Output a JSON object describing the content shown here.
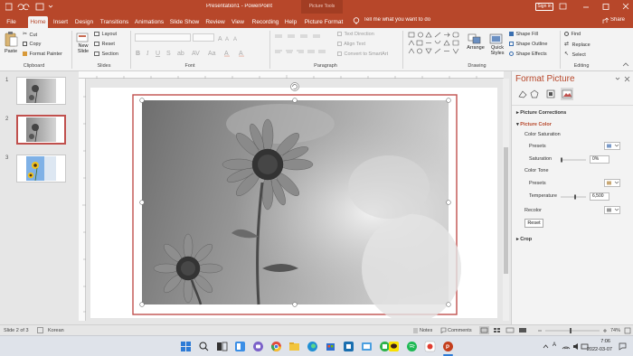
{
  "title_bar": {
    "document_title": "Presentation1 - PowerPoint",
    "context_label": "Picture Tools",
    "sign_in": "Sign in"
  },
  "tabs": [
    "File",
    "Home",
    "Insert",
    "Design",
    "Transitions",
    "Animations",
    "Slide Show",
    "Review",
    "View",
    "Recording",
    "Help",
    "Picture Format"
  ],
  "tell_me": "Tell me what you want to do",
  "share": "Share",
  "ribbon": {
    "clipboard": {
      "paste": "Paste",
      "cut": "Cut",
      "copy": "Copy",
      "format_painter": "Format Painter",
      "label": "Clipboard"
    },
    "slides": {
      "new_slide": "New",
      "new_slide2": "Slide",
      "layout": "Layout",
      "reset": "Reset",
      "section": "Section",
      "label": "Slides"
    },
    "font": {
      "label": "Font"
    },
    "paragraph": {
      "text_direction": "Text Direction",
      "align_text": "Align Text",
      "convert_smartart": "Convert to SmartArt",
      "label": "Paragraph"
    },
    "drawing": {
      "arrange": "Arrange",
      "quick_styles": "Quick",
      "quick_styles2": "Styles",
      "shape_fill": "Shape Fill",
      "shape_outline": "Shape Outline",
      "shape_effects": "Shape Effects",
      "label": "Drawing"
    },
    "editing": {
      "find": "Find",
      "replace": "Replace",
      "select": "Select",
      "label": "Editing"
    }
  },
  "thumbnails": [
    "1",
    "2",
    "3"
  ],
  "format_picture": {
    "title": "Format Picture",
    "picture_corrections": "Picture Corrections",
    "picture_color": "Picture Color",
    "color_saturation": "Color Saturation",
    "presets": "Presets",
    "saturation": "Saturation",
    "saturation_value": "0%",
    "color_tone": "Color Tone",
    "presets2": "Presets",
    "temperature": "Temperature",
    "temperature_value": "6,500",
    "recolor": "Recolor",
    "reset": "Reset",
    "crop": "Crop"
  },
  "status": {
    "slide_of": "Slide 2 of 3",
    "language": "Korean",
    "notes": "Notes",
    "comments": "Comments",
    "zoom": "74%"
  },
  "taskbar": {
    "time": "7:06",
    "date": "2022-03-07",
    "ime": "A"
  },
  "colors": {
    "accent": "#b7472a",
    "selection": "#c0504d"
  }
}
